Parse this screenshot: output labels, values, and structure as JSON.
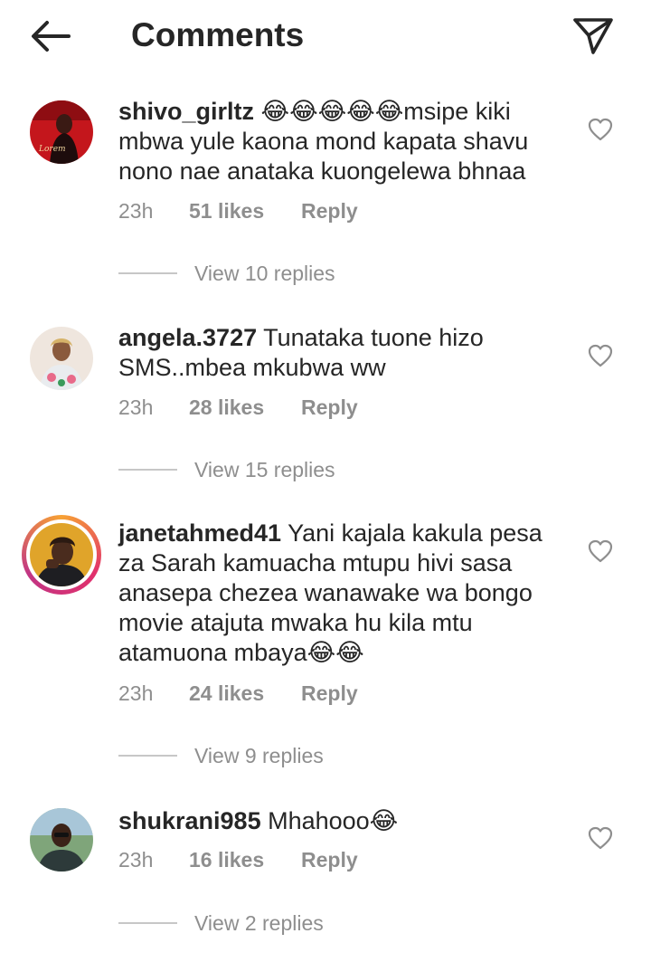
{
  "header": {
    "title": "Comments",
    "back_icon": "arrow-left-icon",
    "send_icon": "paper-plane-icon"
  },
  "comments": [
    {
      "username": "shivo_girltz",
      "text": " 😂😂😂😂😂msipe kiki mbwa yule kaona mond kapata shavu nono nae anataka kuongelewa bhnaa",
      "time": "23h",
      "likes": "51 likes",
      "reply": "Reply",
      "replies": "View 10 replies"
    },
    {
      "username": "angela.3727",
      "text": " Tunataka tuone hizo SMS..mbea mkubwa ww",
      "time": "23h",
      "likes": "28 likes",
      "reply": "Reply",
      "replies": "View 15 replies"
    },
    {
      "username": "janetahmed41",
      "text": " Yani kajala kakula pesa za Sarah kamuacha mtupu hivi sasa anasepa chezea wanawake wa bongo movie atajuta mwaka hu  kila mtu atamuona mbaya😂😂",
      "time": "23h",
      "likes": "24 likes",
      "reply": "Reply",
      "replies": "View 9 replies"
    },
    {
      "username": "shukrani985",
      "text": " Mhahooo😂",
      "time": "23h",
      "likes": "16 likes",
      "reply": "Reply",
      "replies": "View 2 replies"
    }
  ],
  "colors": {
    "text": "#262626",
    "muted": "#8e8e8e",
    "story_ring": "#e1306c"
  }
}
